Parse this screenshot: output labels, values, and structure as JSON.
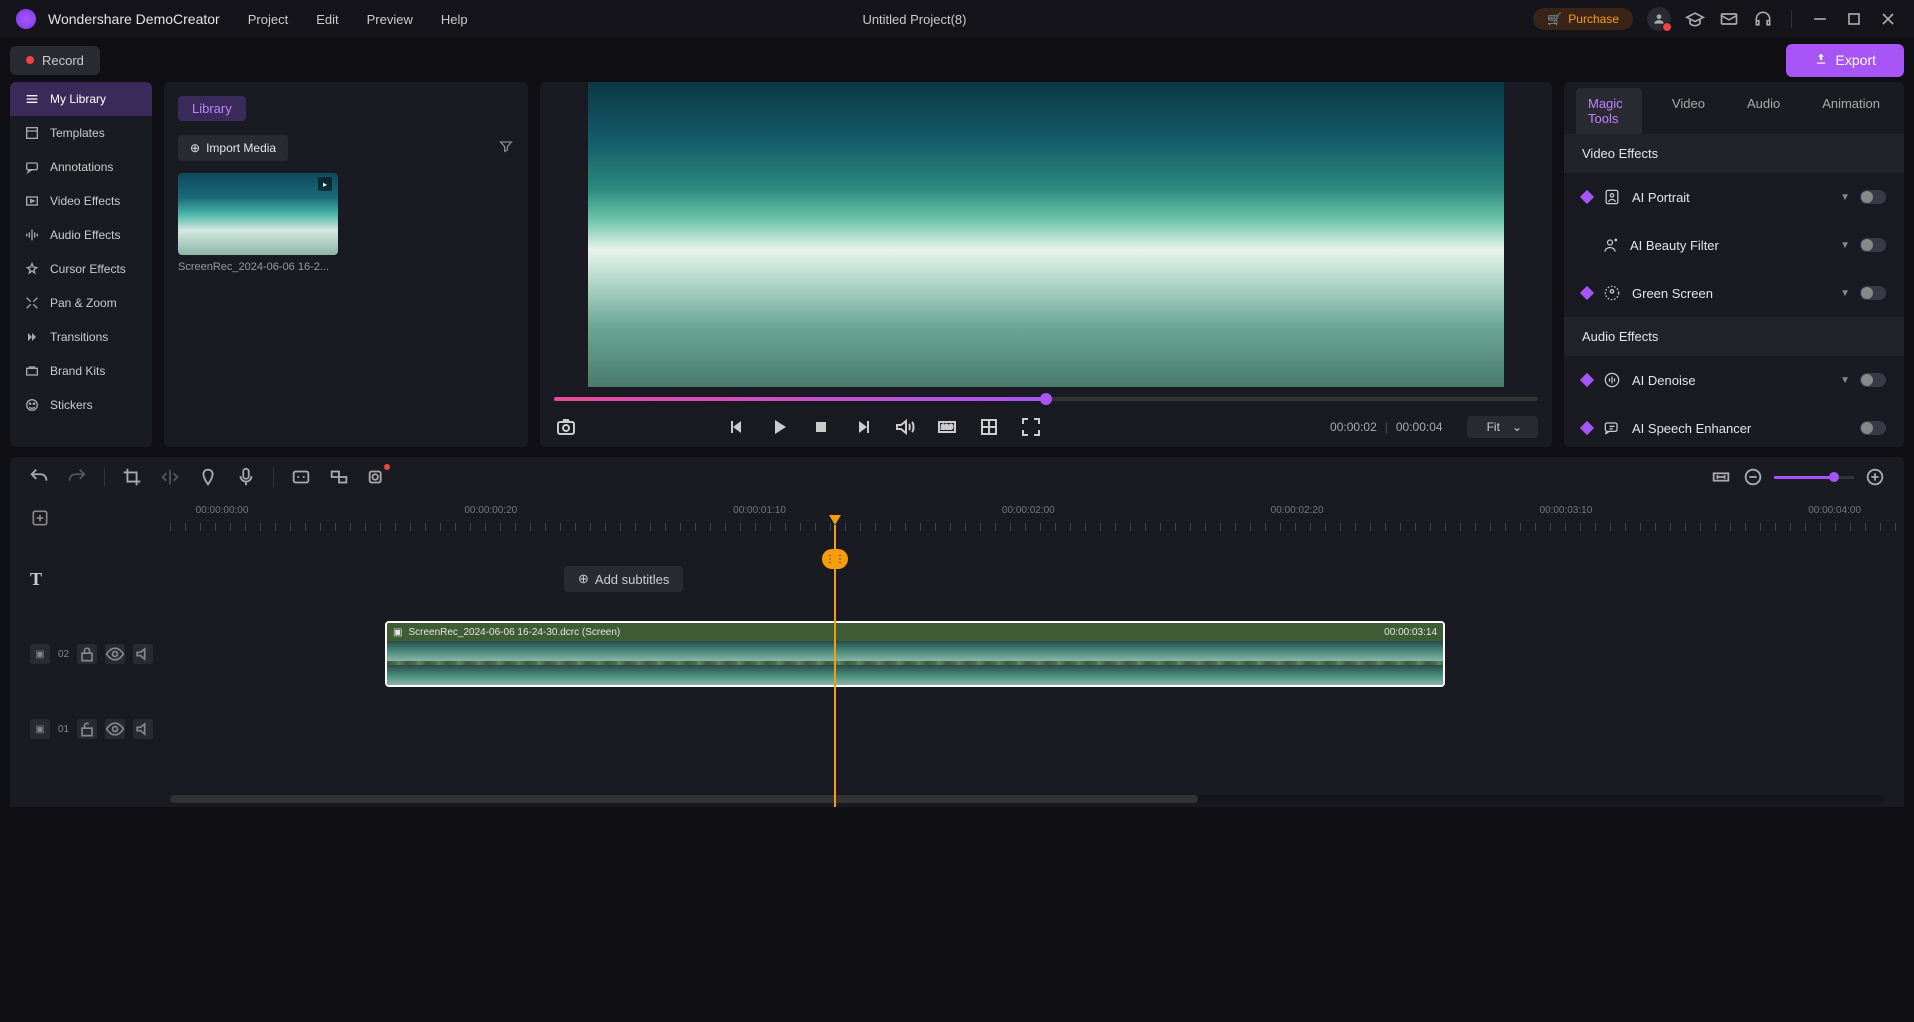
{
  "app": {
    "name": "Wondershare DemoCreator"
  },
  "menu": [
    "Project",
    "Edit",
    "Preview",
    "Help"
  ],
  "project_title": "Untitled Project(8)",
  "titlebar": {
    "purchase": "Purchase"
  },
  "toolbar": {
    "record": "Record",
    "export": "Export"
  },
  "sidebar": {
    "items": [
      {
        "label": "My Library"
      },
      {
        "label": "Templates"
      },
      {
        "label": "Annotations"
      },
      {
        "label": "Video Effects"
      },
      {
        "label": "Audio Effects"
      },
      {
        "label": "Cursor Effects"
      },
      {
        "label": "Pan & Zoom"
      },
      {
        "label": "Transitions"
      },
      {
        "label": "Brand Kits"
      },
      {
        "label": "Stickers"
      }
    ]
  },
  "library": {
    "title": "Library",
    "import": "Import Media",
    "media": [
      {
        "name": "ScreenRec_2024-06-06 16-2..."
      }
    ]
  },
  "preview": {
    "current_time": "00:00:02",
    "total_time": "00:00:04",
    "fit_label": "Fit",
    "progress_pct": 50
  },
  "props": {
    "tabs": [
      "Magic Tools",
      "Video",
      "Audio",
      "Animation"
    ],
    "section_video": "Video Effects",
    "section_audio": "Audio Effects",
    "rows": [
      {
        "label": "AI Portrait"
      },
      {
        "label": "AI Beauty Filter"
      },
      {
        "label": "Green Screen"
      },
      {
        "label": "AI Denoise"
      },
      {
        "label": "AI Speech Enhancer"
      }
    ]
  },
  "timeline": {
    "ruler_labels": [
      "00:00:00:00",
      "00:00:00:20",
      "00:00:01:10",
      "00:00:02:00",
      "00:00:02:20",
      "00:00:03:10",
      "00:00:04:00"
    ],
    "add_subtitles": "Add subtitles",
    "tracks": [
      {
        "num": "02"
      },
      {
        "num": "01"
      }
    ],
    "clip": {
      "name": "ScreenRec_2024-06-06 16-24-30.dcrc (Screen)",
      "duration": "00:00:03:14"
    },
    "playhead_pct": 50
  }
}
